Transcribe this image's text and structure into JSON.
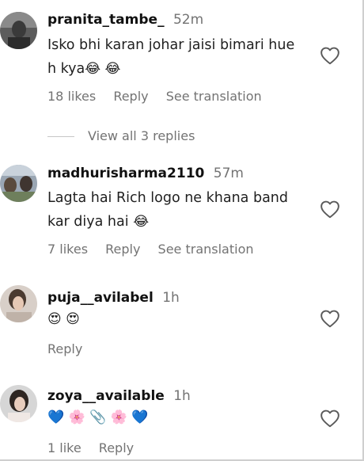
{
  "comments": [
    {
      "username": "pranita_tambe_",
      "time": "52m",
      "text_line1": "Isko bhi karan johar jaisi bimari hue",
      "text_line2": "h kya",
      "emojis": "😂 😂",
      "likes": "18 likes",
      "reply": "Reply",
      "translate": "See translation",
      "view_replies": "View all 3 replies"
    },
    {
      "username": "madhurisharma2110",
      "time": "57m",
      "text_line1": "Lagta hai Rich logo ne khana band",
      "text_line2": "kar diya hai",
      "emojis": "😂",
      "likes": "7 likes",
      "reply": "Reply",
      "translate": "See translation"
    },
    {
      "username": "puja__avilabel",
      "time": "1h",
      "emojis": "😍 😍",
      "reply": "Reply"
    },
    {
      "username": "zoya__available",
      "time": "1h",
      "emojis": "💙 🌸 📎 🌸 💙",
      "likes": "1 like",
      "reply": "Reply"
    }
  ],
  "icons": {
    "heart": "heart-outline-icon"
  },
  "colors": {
    "username": "#111111",
    "meta": "#737373",
    "text": "#1f1f1f"
  }
}
